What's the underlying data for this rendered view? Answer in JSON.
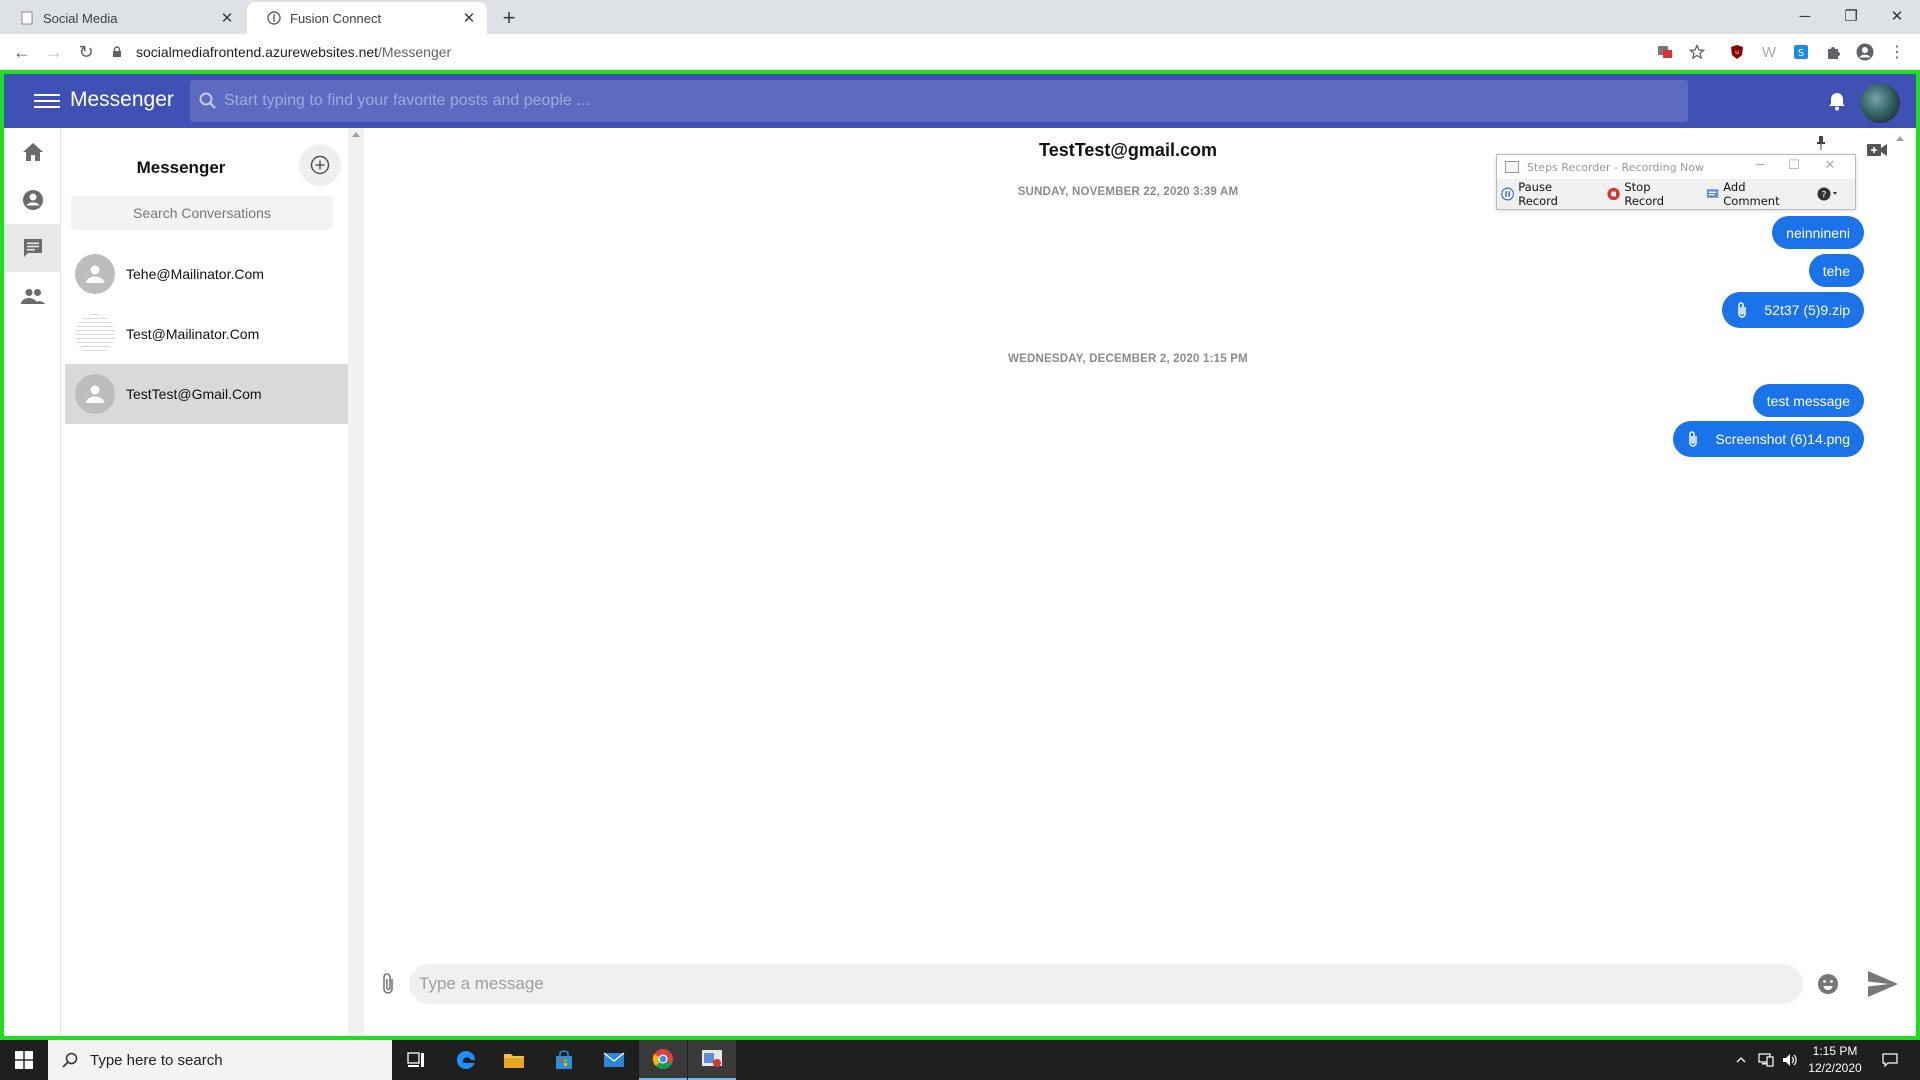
{
  "browser": {
    "tabs": [
      {
        "title": "Social Media",
        "active": false
      },
      {
        "title": "Fusion Connect",
        "active": true
      }
    ],
    "url_host": "socialmediafrontend.azurewebsites.net",
    "url_path": "/Messenger"
  },
  "appbar": {
    "title": "Messenger",
    "search_placeholder": "Start typing to find your favorite posts and people ...",
    "color": "#3f51b5"
  },
  "rail": {
    "items": [
      {
        "icon": "home-icon",
        "selected": false
      },
      {
        "icon": "account-circle-icon",
        "selected": false
      },
      {
        "icon": "chat-icon",
        "selected": true
      },
      {
        "icon": "people-icon",
        "selected": false
      }
    ]
  },
  "conversations": {
    "title": "Messenger",
    "search_placeholder": "Search Conversations",
    "items": [
      {
        "name": "Tehe@Mailinator.Com",
        "selected": false
      },
      {
        "name": "Test@Mailinator.Com",
        "selected": false
      },
      {
        "name": "TestTest@Gmail.Com",
        "selected": true
      }
    ]
  },
  "chat": {
    "header": "TestTest@gmail.com",
    "groups": [
      {
        "date": "SUNDAY, NOVEMBER 22, 2020 3:39 AM",
        "messages": [
          {
            "text": "neinnineni",
            "attachment": false
          },
          {
            "text": "tehe",
            "attachment": false
          },
          {
            "text": "52t37 (5)9.zip",
            "attachment": true
          }
        ]
      },
      {
        "date": "WEDNESDAY, DECEMBER 2, 2020 1:15 PM",
        "messages": [
          {
            "text": "test message",
            "attachment": false
          },
          {
            "text": "Screenshot (6)14.png",
            "attachment": true
          }
        ]
      }
    ],
    "composer_placeholder": "Type a message",
    "bubble_color": "#1a73e8"
  },
  "steps_recorder": {
    "title": "Steps Recorder - Recording Now",
    "pause": "Pause Record",
    "stop": "Stop Record",
    "comment": "Add Comment"
  },
  "taskbar": {
    "search_placeholder": "Type here to search",
    "time": "1:15 PM",
    "date": "12/2/2020"
  }
}
